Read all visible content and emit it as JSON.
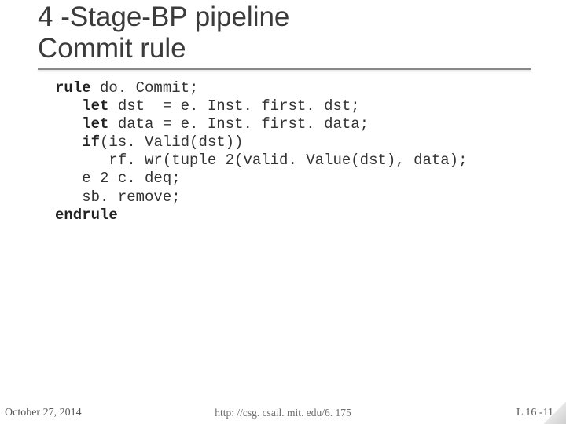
{
  "title_line1": "4 -Stage-BP pipeline",
  "title_line2": "Commit rule",
  "code": {
    "kw_rule": "rule",
    "l1_rest": " do. Commit;",
    "kw_let1": "let",
    "l2_rest": " dst  = e. Inst. first. dst;",
    "kw_let2": "let",
    "l3_rest": " data = e. Inst. first. data;",
    "kw_if": "if",
    "l4_rest": "(is. Valid(dst))",
    "l5": "      rf. wr(tuple 2(valid. Value(dst), data);",
    "l6": "   e 2 c. deq;",
    "l7": "   sb. remove;",
    "kw_endrule": "endrule"
  },
  "footer": {
    "left": "October 27, 2014",
    "center": "http: //csg. csail. mit. edu/6. 175",
    "right": "L 16 -11"
  }
}
